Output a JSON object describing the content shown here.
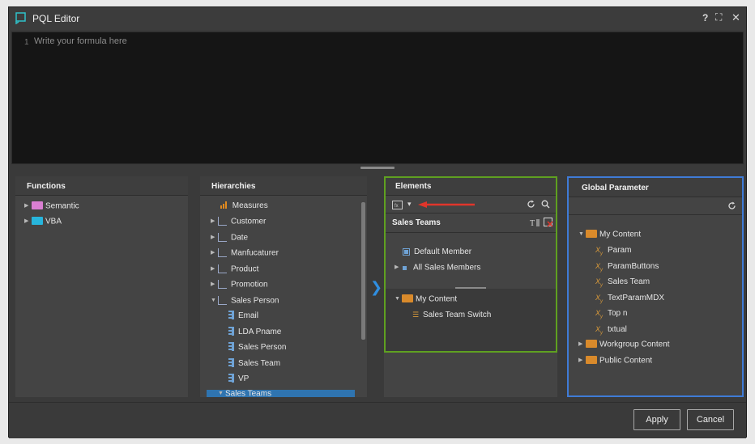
{
  "window": {
    "title": "PQL Editor",
    "help": "?",
    "maximize": "⛶",
    "close": "✕"
  },
  "editor": {
    "line_number": "1",
    "placeholder": "Write your formula here"
  },
  "functions": {
    "title": "Functions",
    "items": [
      {
        "label": "Semantic",
        "color": "#d97fd2"
      },
      {
        "label": "VBA",
        "color": "#27b5dc"
      }
    ]
  },
  "hierarchies": {
    "title": "Hierarchies",
    "items": [
      {
        "label": "Measures"
      },
      {
        "label": "Customer"
      },
      {
        "label": "Date"
      },
      {
        "label": "Manfucaturer"
      },
      {
        "label": "Product"
      },
      {
        "label": "Promotion"
      },
      {
        "label": "Sales Person"
      },
      {
        "label": "Email"
      },
      {
        "label": "LDA Pname"
      },
      {
        "label": "Sales Person"
      },
      {
        "label": "Sales Team"
      },
      {
        "label": "VP"
      },
      {
        "label": "Sales Teams"
      }
    ]
  },
  "elements": {
    "title": "Elements",
    "dropdown_caret": "▾",
    "hierarchy_name": "Sales Teams",
    "members": [
      {
        "label": "Default Member"
      },
      {
        "label": "All Sales Members"
      }
    ],
    "content": [
      {
        "label": "My Content"
      },
      {
        "label": "Sales Team Switch"
      }
    ],
    "accent": "#5fa020"
  },
  "global_parameter": {
    "title": "Global Parameter",
    "accent": "#3f7bd6",
    "my_content": "My Content",
    "params": [
      {
        "label": "Param"
      },
      {
        "label": "ParamButtons"
      },
      {
        "label": "Sales Team"
      },
      {
        "label": "TextParamMDX"
      },
      {
        "label": "Top n"
      },
      {
        "label": "txtual"
      }
    ],
    "workgroup": "Workgroup Content",
    "public": "Public Content"
  },
  "footer": {
    "apply_label": "Apply",
    "cancel_label": "Cancel"
  }
}
